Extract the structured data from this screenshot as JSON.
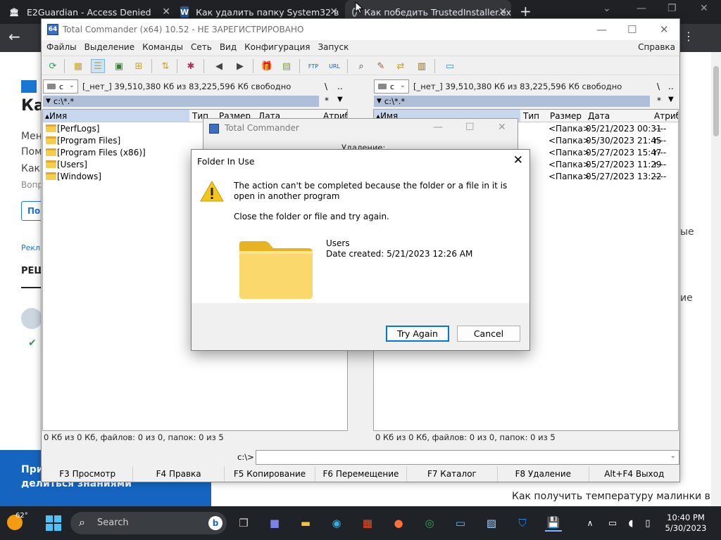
{
  "browser": {
    "tabs": [
      {
        "title": "E2Guardian - Access Denied"
      },
      {
        "title": "Как удалить папку System32 в W"
      },
      {
        "title": "Как победить TrustedInstaller.ex"
      }
    ]
  },
  "webpage": {
    "snippets": [
      "W",
      "Ка",
      "Мен",
      "Пом",
      "Как",
      "Вопр",
      "Под",
      "Рекл",
      "РЕШ",
      "Приг",
      "делиться знаниями",
      "ые",
      "ие",
      "Как получить температуру малинки в"
    ]
  },
  "total_commander": {
    "title": "Total Commander (x64) 10.52 - НЕ ЗАРЕГИСТРИРОВАНО",
    "menu": [
      "Файлы",
      "Выделение",
      "Команды",
      "Сеть",
      "Вид",
      "Конфигурация",
      "Запуск"
    ],
    "menu_right": "Справка",
    "left": {
      "drive": "c",
      "drive_info": "[_нет_]  39,510,380 Кб из 83,225,596 Кб свободно",
      "path": "c:\\*.*",
      "headers": [
        "Имя",
        "Тип",
        "Размер",
        "Дата",
        "Атриб"
      ],
      "files": [
        "[PerfLogs]",
        "[Program Files]",
        "[Program Files (x86)]",
        "[Users]",
        "[Windows]"
      ],
      "status": "0 Кб из 0 Кб, файлов: 0 из 0, папок: 0 из 5"
    },
    "right": {
      "drive": "c",
      "drive_info": "[_нет_]  39,510,380 Кб из 83,225,596 Кб свободно",
      "path": "c:\\*.*",
      "headers": [
        "Имя",
        "Тип",
        "Размер",
        "Дата",
        "Атриб"
      ],
      "rows": [
        {
          "size": "<Папка>",
          "date": "05/21/2023 00:31",
          "attr": "----"
        },
        {
          "size": "<Папка>",
          "date": "05/30/2023 21:45",
          "attr": "r---"
        },
        {
          "size": "<Папка>",
          "date": "05/27/2023 15:47",
          "attr": "r---"
        },
        {
          "size": "<Папка>",
          "date": "05/27/2023 11:29",
          "attr": "r---"
        },
        {
          "size": "<Папка>",
          "date": "05/27/2023 13:22",
          "attr": "----"
        }
      ],
      "status": "0 Кб из 0 Кб, файлов: 0 из 0, папок: 0 из 5"
    },
    "path_extras": {
      "backslash": "\\",
      "dots": "..",
      "star": "*"
    },
    "cmd_prompt": "c:\\>",
    "fkeys": [
      "F3 Просмотр",
      "F4 Правка",
      "F5 Копирование",
      "F6 Перемещение",
      "F7 Каталог",
      "F8 Удаление",
      "Alt+F4 Выход"
    ]
  },
  "tc_dialog": {
    "title": "Total Commander",
    "subtitle": "Удаление:"
  },
  "folder_in_use": {
    "title": "Folder In Use",
    "message1": "The action can't be completed because the folder or a file in it is open in another program",
    "message2": "Close the folder or file and try again.",
    "item_name": "Users",
    "item_date": "Date created: 5/21/2023 12:26 AM",
    "try_again": "Try Again",
    "cancel": "Cancel"
  },
  "taskbar": {
    "weather": "62°",
    "search": "Search",
    "time": "10:40 PM",
    "date": "5/30/2023"
  },
  "colors": {
    "accent": "#0078d7",
    "path_bar": "#b0bfd8",
    "webpage_banner": "#1565c0"
  }
}
